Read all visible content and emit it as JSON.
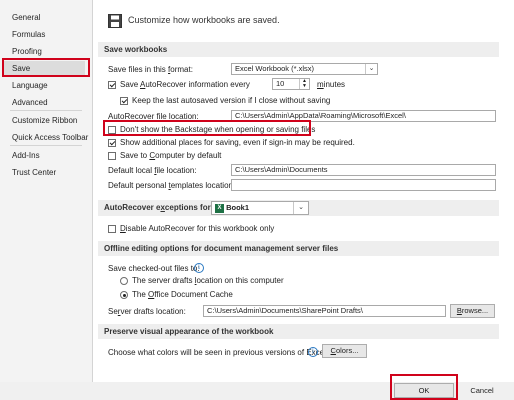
{
  "sidebar": {
    "items": [
      {
        "label": "General"
      },
      {
        "label": "Formulas"
      },
      {
        "label": "Proofing"
      },
      {
        "label": "Save"
      },
      {
        "label": "Language"
      },
      {
        "label": "Advanced"
      },
      {
        "label": "Customize Ribbon"
      },
      {
        "label": "Quick Access Toolbar"
      },
      {
        "label": "Add-Ins"
      },
      {
        "label": "Trust Center"
      }
    ],
    "selected": "Save"
  },
  "header": {
    "icon": "save-disk-icon",
    "title": "Customize how workbooks are saved."
  },
  "save_workbooks": {
    "heading": "Save workbooks",
    "format_label_pre": "Save files in this ",
    "format_label_key": "f",
    "format_label_post": "ormat:",
    "format_value": "Excel Workbook (*.xlsx)",
    "autorecover_pre": "Save ",
    "autorecover_key": "A",
    "autorecover_post": "utoRecover information every",
    "autorecover_minutes": "10",
    "minutes_label_key": "m",
    "minutes_label_post": "inutes",
    "keep_last": "Keep the last autosaved version if I close without saving",
    "ar_location_pre": "Auto",
    "ar_location_key": "R",
    "ar_location_post": "ecover file location:",
    "ar_location_value": "C:\\Users\\Admin\\AppData\\Roaming\\Microsoft\\Excel\\",
    "dont_show_backstage": "Don't show the Backstage when opening or saving files",
    "show_additional": "Show additional places for saving, even if sign-in may be required.",
    "save_to_computer_pre": "Save to ",
    "save_to_computer_key": "C",
    "save_to_computer_post": "omputer by default",
    "default_local_pre": "Default local ",
    "default_local_key": "f",
    "default_local_post": "ile location:",
    "default_local_value": "C:\\Users\\Admin\\Documents",
    "default_personal_pre": "Default personal ",
    "default_personal_key": "t",
    "default_personal_post": "emplates location:",
    "default_personal_value": "",
    "checks": {
      "autorecover": true,
      "keep_last": true,
      "dont_show_backstage": false,
      "show_additional": true,
      "save_to_computer": false
    }
  },
  "autorecover_exceptions": {
    "label_pre": "AutoRecover e",
    "label_key": "x",
    "label_post": "ceptions for:",
    "workbook": "Book1",
    "excel_icon_letter": "X",
    "disable_pre": "",
    "disable_key": "D",
    "disable_post": "isable AutoRecover for this workbook only",
    "disable_checked": false
  },
  "offline": {
    "heading": "Offline editing options for document management server files",
    "checked_out_label": "Save checked-out files to:",
    "info_icon": "info-icon",
    "radio1_pre": "The server drafts ",
    "radio1_key": "l",
    "radio1_post": "ocation on this computer",
    "radio2_pre": "The ",
    "radio2_key": "O",
    "radio2_post": "ffice Document Cache",
    "selected_radio": 2,
    "server_drafts_pre": "Se",
    "server_drafts_key": "r",
    "server_drafts_post": "ver drafts location:",
    "server_drafts_value": "C:\\Users\\Admin\\Documents\\SharePoint Drafts\\",
    "browse_pre": "",
    "browse_key": "B",
    "browse_post": "rowse..."
  },
  "preserve": {
    "heading": "Preserve visual appearance of the workbook",
    "choose_colors": "Choose what colors will be seen in previous versions of Excel:",
    "colors_pre": "",
    "colors_key": "C",
    "colors_post": "olors..."
  },
  "footer": {
    "ok": "OK",
    "cancel": "Cancel"
  },
  "colors": {
    "highlight": "#d0021b",
    "excel_green": "#1e7145",
    "info_blue": "#2b79c2"
  }
}
